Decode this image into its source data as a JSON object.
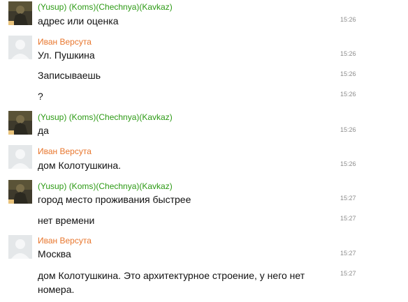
{
  "authors": {
    "yusup": "(Yusup) (Koms)(Chechnya)(Kavkaz)",
    "ivan": "Иван Версута"
  },
  "colors": {
    "yusup_name": "#2c9a14",
    "ivan_name": "#e8762d",
    "timestamp": "#8c8c8c"
  },
  "avatars": {
    "yusup": "photo-avatar-icon",
    "ivan": "default-avatar-icon"
  },
  "messages": [
    {
      "author": "(Yusup) (Koms)(Chechnya)(Kavkaz)",
      "text": "адрес или оценка",
      "time": "15:26"
    },
    {
      "author": "Иван Версута",
      "text": "Ул. Пушкина",
      "time": "15:26"
    },
    {
      "text": "Записываешь",
      "time": "15:26"
    },
    {
      "text": "?",
      "time": "15:26"
    },
    {
      "author": "(Yusup) (Koms)(Chechnya)(Kavkaz)",
      "text": "да",
      "time": "15:26"
    },
    {
      "author": "Иван Версута",
      "text": "дом Колотушкина.",
      "time": "15:26"
    },
    {
      "author": "(Yusup) (Koms)(Chechnya)(Kavkaz)",
      "text": "город место проживания быстрее",
      "time": "15:27"
    },
    {
      "text": "нет времени",
      "time": "15:27"
    },
    {
      "author": "Иван Версута",
      "text": "Москва",
      "time": "15:27"
    },
    {
      "text": "дом Колотушкина. Это архитектурное строение, у него нет номера.",
      "time": "15:27"
    }
  ]
}
